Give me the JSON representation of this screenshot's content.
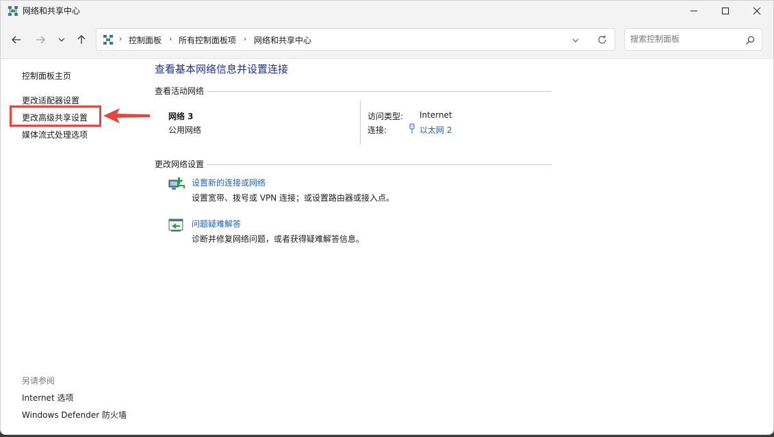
{
  "window": {
    "title": "网络和共享中心"
  },
  "address": {
    "crumbs": [
      "控制面板",
      "所有控制面板项",
      "网络和共享中心"
    ]
  },
  "search": {
    "placeholder": "搜索控制面板"
  },
  "left_pane": {
    "home": "控制面板主页",
    "links": [
      "更改适配器设置",
      "更改高级共享设置",
      "媒体流式处理选项"
    ],
    "see_also_title": "另请参阅",
    "see_also": [
      "Internet 选项",
      "Windows Defender 防火墙"
    ]
  },
  "main": {
    "title": "查看基本网络信息并设置连接",
    "active_networks_heading": "查看活动网络",
    "network": {
      "name": "网络 3",
      "category": "公用网络",
      "access_type_label": "访问类型:",
      "access_type_value": "Internet",
      "connections_label": "连接:",
      "connection_name": "以太网 2"
    },
    "change_settings_heading": "更改网络设置",
    "tasks": [
      {
        "link": "设置新的连接或网络",
        "description": "设置宽带、拨号或 VPN 连接；或设置路由器或接入点。",
        "icon": "new-connection-icon"
      },
      {
        "link": "问题疑难解答",
        "description": "诊断并修复网络问题，或者获得疑难解答信息。",
        "icon": "troubleshoot-icon"
      }
    ]
  },
  "colors": {
    "title_blue": "#1e3287",
    "link_blue": "#1e63c4",
    "highlight_red": "#e8453c"
  }
}
